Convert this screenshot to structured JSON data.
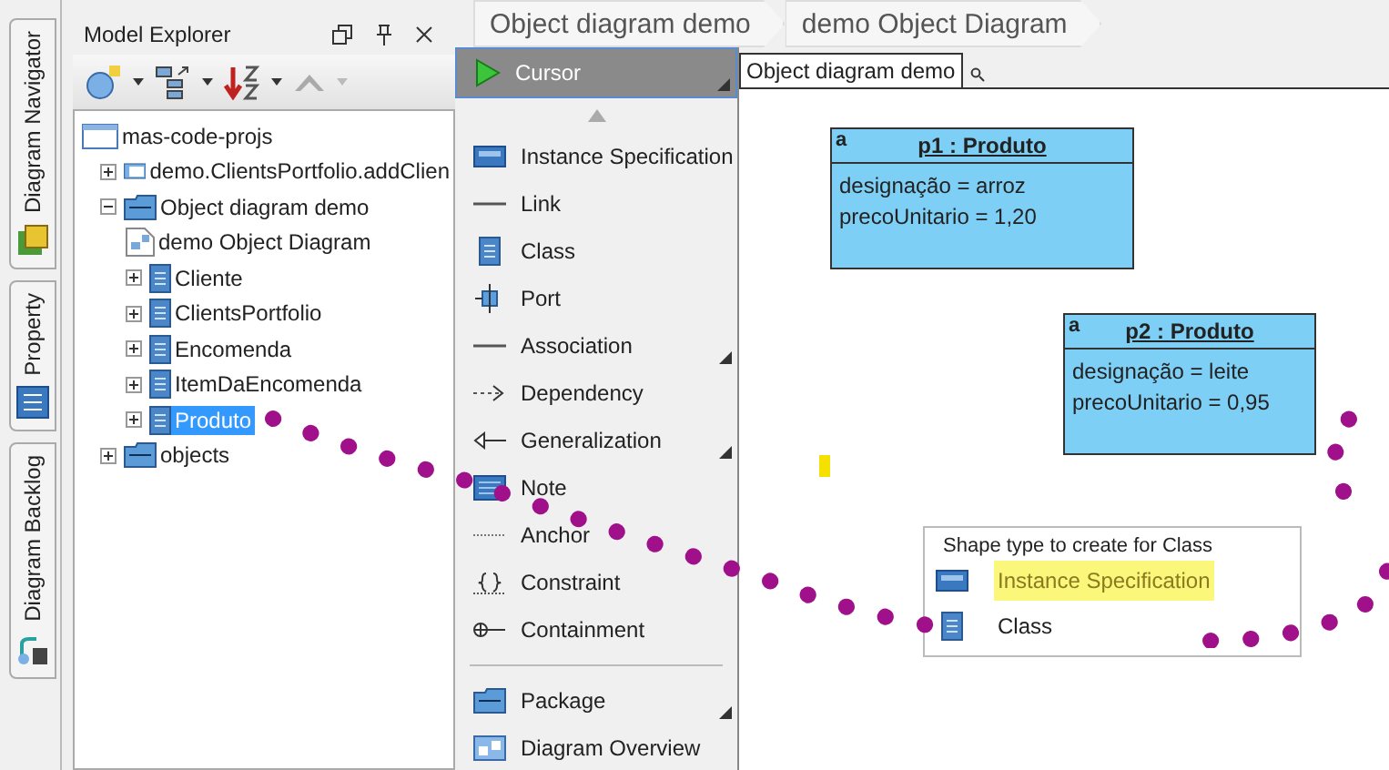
{
  "side_tabs": [
    {
      "label": "Diagram Navigator",
      "kind": "navigator"
    },
    {
      "label": "Property",
      "kind": "property"
    },
    {
      "label": "Diagram Backlog",
      "kind": "backlog"
    }
  ],
  "model_explorer": {
    "title": "Model Explorer",
    "tree": [
      {
        "label": "mas-code-projs",
        "kind": "project",
        "selected": false,
        "children": [
          {
            "label": "demo.ClientsPortfolio.addClien",
            "kind": "diagram-folder",
            "expanded": false,
            "selected": false
          },
          {
            "label": "Object diagram demo",
            "kind": "package",
            "expanded": true,
            "selected": false,
            "children": [
              {
                "label": "demo Object Diagram",
                "kind": "diagram",
                "selected": false
              },
              {
                "label": "Cliente",
                "kind": "class",
                "expanded": false,
                "selected": false
              },
              {
                "label": "ClientsPortfolio",
                "kind": "class",
                "expanded": false,
                "selected": false
              },
              {
                "label": "Encomenda",
                "kind": "class",
                "expanded": false,
                "selected": false
              },
              {
                "label": "ItemDaEncomenda",
                "kind": "class",
                "expanded": false,
                "selected": false
              },
              {
                "label": "Produto",
                "kind": "class",
                "expanded": false,
                "selected": true
              }
            ]
          },
          {
            "label": "objects",
            "kind": "package",
            "expanded": false,
            "selected": false
          }
        ]
      }
    ]
  },
  "breadcrumb": [
    "Object diagram demo",
    "demo Object Diagram"
  ],
  "palette": {
    "items": [
      {
        "label": "Cursor",
        "kind": "cursor",
        "selected": true,
        "submenu": true
      },
      {
        "label": "Instance Specification",
        "kind": "instance",
        "selected": false,
        "submenu": false
      },
      {
        "label": "Link",
        "kind": "line",
        "selected": false,
        "submenu": false
      },
      {
        "label": "Class",
        "kind": "class",
        "selected": false,
        "submenu": false
      },
      {
        "label": "Port",
        "kind": "port",
        "selected": false,
        "submenu": false
      },
      {
        "label": "Association",
        "kind": "line",
        "selected": false,
        "submenu": true
      },
      {
        "label": "Dependency",
        "kind": "dependency",
        "selected": false,
        "submenu": false
      },
      {
        "label": "Generalization",
        "kind": "generalization",
        "selected": false,
        "submenu": true
      },
      {
        "label": "Note",
        "kind": "note",
        "selected": false,
        "submenu": false
      },
      {
        "label": "Anchor",
        "kind": "anchor",
        "selected": false,
        "submenu": false
      },
      {
        "label": "Constraint",
        "kind": "constraint",
        "selected": false,
        "submenu": false
      },
      {
        "label": "Containment",
        "kind": "containment",
        "selected": false,
        "submenu": false
      },
      {
        "label": "Package",
        "kind": "package",
        "selected": false,
        "submenu": true,
        "separator_before": true
      },
      {
        "label": "Diagram Overview",
        "kind": "overview",
        "selected": false,
        "submenu": false
      }
    ]
  },
  "diagram_tab": {
    "label": "Object diagram demo"
  },
  "objects": [
    {
      "marker": "a",
      "title": "p1 : Produto",
      "attributes": [
        "designação = arroz",
        "precoUnitario = 1,20"
      ]
    },
    {
      "marker": "a",
      "title": "p2 : Produto",
      "attributes": [
        "designação = leite",
        "precoUnitario = 0,95"
      ]
    }
  ],
  "shape_popup": {
    "title": "Shape type to create for Class",
    "options": [
      {
        "label": "Instance Specification",
        "kind": "instance",
        "highlighted": true
      },
      {
        "label": "Class",
        "kind": "class",
        "highlighted": false
      }
    ]
  }
}
